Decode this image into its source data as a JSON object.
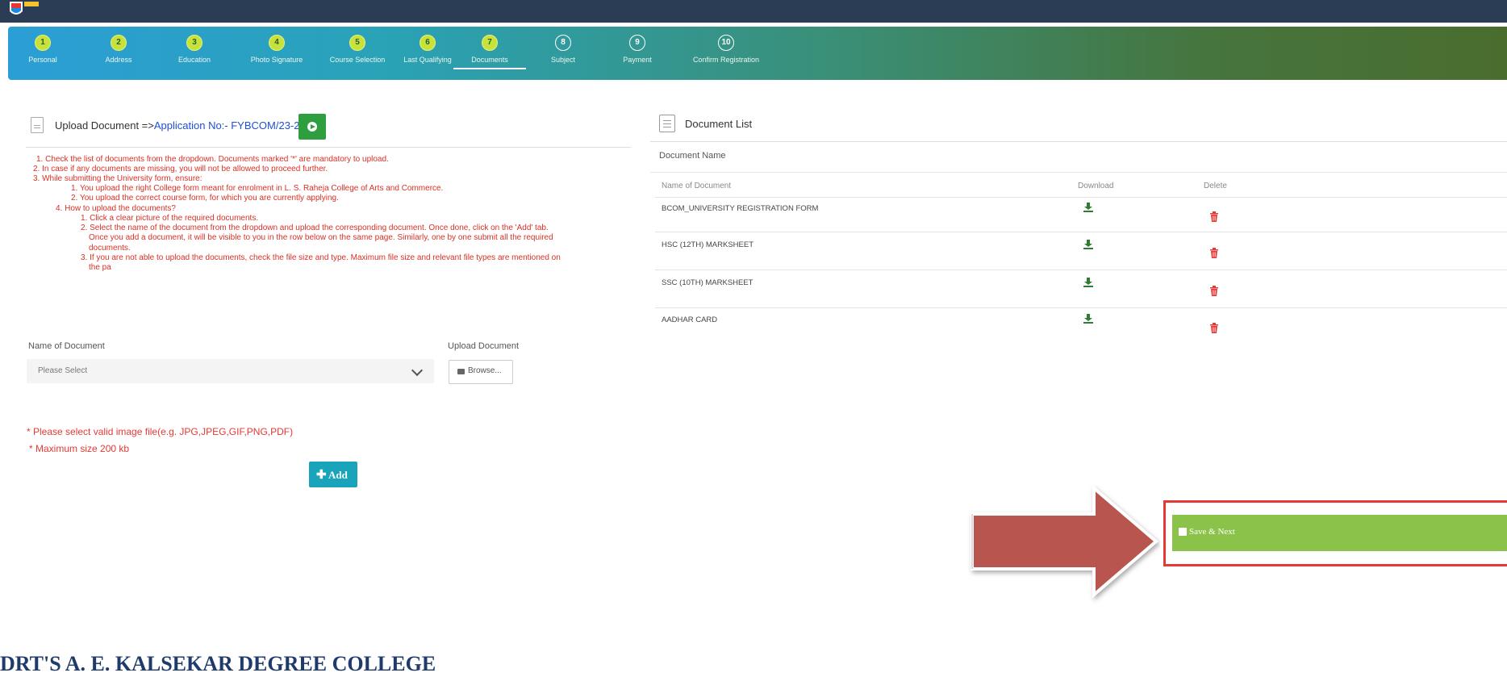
{
  "steps": [
    {
      "num": "1",
      "label": "Personal",
      "state": "done"
    },
    {
      "num": "2",
      "label": "Address",
      "state": "done"
    },
    {
      "num": "3",
      "label": "Education",
      "state": "done"
    },
    {
      "num": "4",
      "label": "Photo Signature",
      "state": "done"
    },
    {
      "num": "5",
      "label": "Course Selection",
      "state": "done"
    },
    {
      "num": "6",
      "label": "Last Qualifying",
      "state": "done"
    },
    {
      "num": "7",
      "label": "Documents",
      "state": "active"
    },
    {
      "num": "8",
      "label": "Subject",
      "state": "todo"
    },
    {
      "num": "9",
      "label": "Payment",
      "state": "todo"
    },
    {
      "num": "10",
      "label": "Confirm Registration",
      "state": "todo"
    }
  ],
  "upload": {
    "title_prefix": "Upload Document =>",
    "application": "Application No:- FYBCOM/23-24/2"
  },
  "instructions": [
    "1. Check the list of documents from the dropdown. Documents marked '*' are mandatory to upload.",
    "2. In case if any documents are missing, you will not be allowed to proceed further.",
    "3. While submitting the University form, ensure:",
    "1. You upload the right College form meant for enrolment in L. S. Raheja College of Arts and Commerce.",
    "2. You upload the correct course form, for which you are currently applying.",
    "4. How to upload the documents?",
    "1. Click a clear picture of the required documents.",
    "2. Select the name of the document from the dropdown and upload the corresponding document. Once done, click on the 'Add' tab.",
    "Once you add a document, it will be visible to you in the row below on the same page. Similarly, one by one submit all the required",
    "documents.",
    "3. If you are not able to upload the documents, check the file size and type. Maximum file size and relevant file types are mentioned on",
    "the pa"
  ],
  "form": {
    "name_label": "Name of Document",
    "upload_label": "Upload Document",
    "select_placeholder": "Please Select",
    "browse_label": "Browse..."
  },
  "notes": {
    "file_types": "* Please select valid image file(e.g. JPG,JPEG,GIF,PNG,PDF)",
    "max_size": "* Maximum size 200 kb"
  },
  "add_label": "Add",
  "college_name": "DRT'S A. E. KALSEKAR DEGREE COLLEGE",
  "doc_list": {
    "title": "Document List",
    "name_label": "Document Name",
    "col_name": "Name of Document",
    "col_download": "Download",
    "col_delete": "Delete",
    "rows": [
      "BCOM_UNIVERSITY REGISTRATION FORM",
      "HSC (12TH) MARKSHEET",
      "SSC (10TH) MARKSHEET",
      "AADHAR CARD"
    ]
  },
  "save_next_label": "Save & Next",
  "colors": {
    "accent_green": "#8bc34a",
    "add_blue": "#19a4bb",
    "error_red": "#d93025",
    "highlight_red": "#e53935"
  }
}
